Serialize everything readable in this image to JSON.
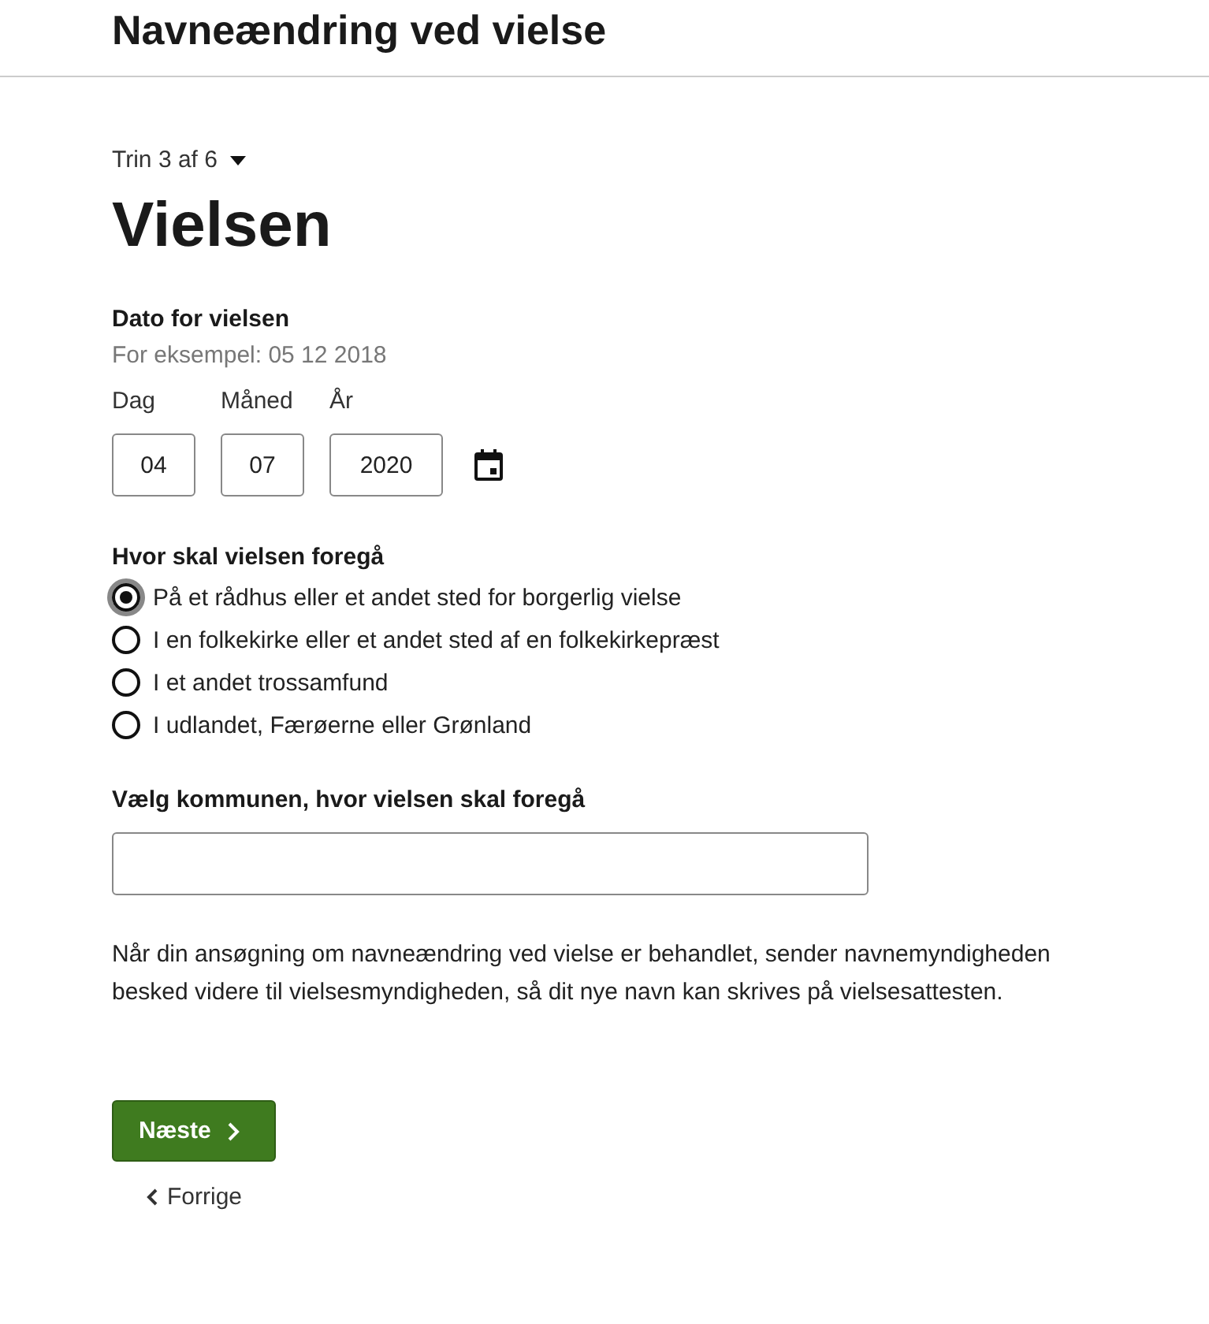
{
  "header": {
    "title": "Navneændring ved vielse"
  },
  "step": {
    "label": "Trin 3 af 6",
    "expanded": false
  },
  "heading": "Vielsen",
  "date": {
    "label": "Dato for vielsen",
    "hint": "For eksempel: 05 12 2018",
    "fields": [
      {
        "label": "Dag",
        "value": "04",
        "kind": "short"
      },
      {
        "label": "Måned",
        "value": "07",
        "kind": "short"
      },
      {
        "label": "År",
        "value": "2020",
        "kind": "long"
      }
    ]
  },
  "place": {
    "label": "Hvor skal vielsen foregå",
    "options": [
      {
        "label": "På et rådhus eller et andet sted for borgerlig vielse",
        "selected": true
      },
      {
        "label": "I en folkekirke eller et andet sted af en folkekirkepræst",
        "selected": false
      },
      {
        "label": "I et andet trossamfund",
        "selected": false
      },
      {
        "label": "I udlandet, Færøerne eller Grønland",
        "selected": false
      }
    ]
  },
  "municipality": {
    "label": "Vælg kommunen, hvor vielsen skal foregå"
  },
  "info": "Når din ansøgning om navneændring ved vielse er behandlet, sender navnemyndigheden besked videre til vielsesmyndigheden, så dit nye navn kan skrives på vielsesattesten.",
  "next_button": "Næste",
  "back_link": "Forrige"
}
